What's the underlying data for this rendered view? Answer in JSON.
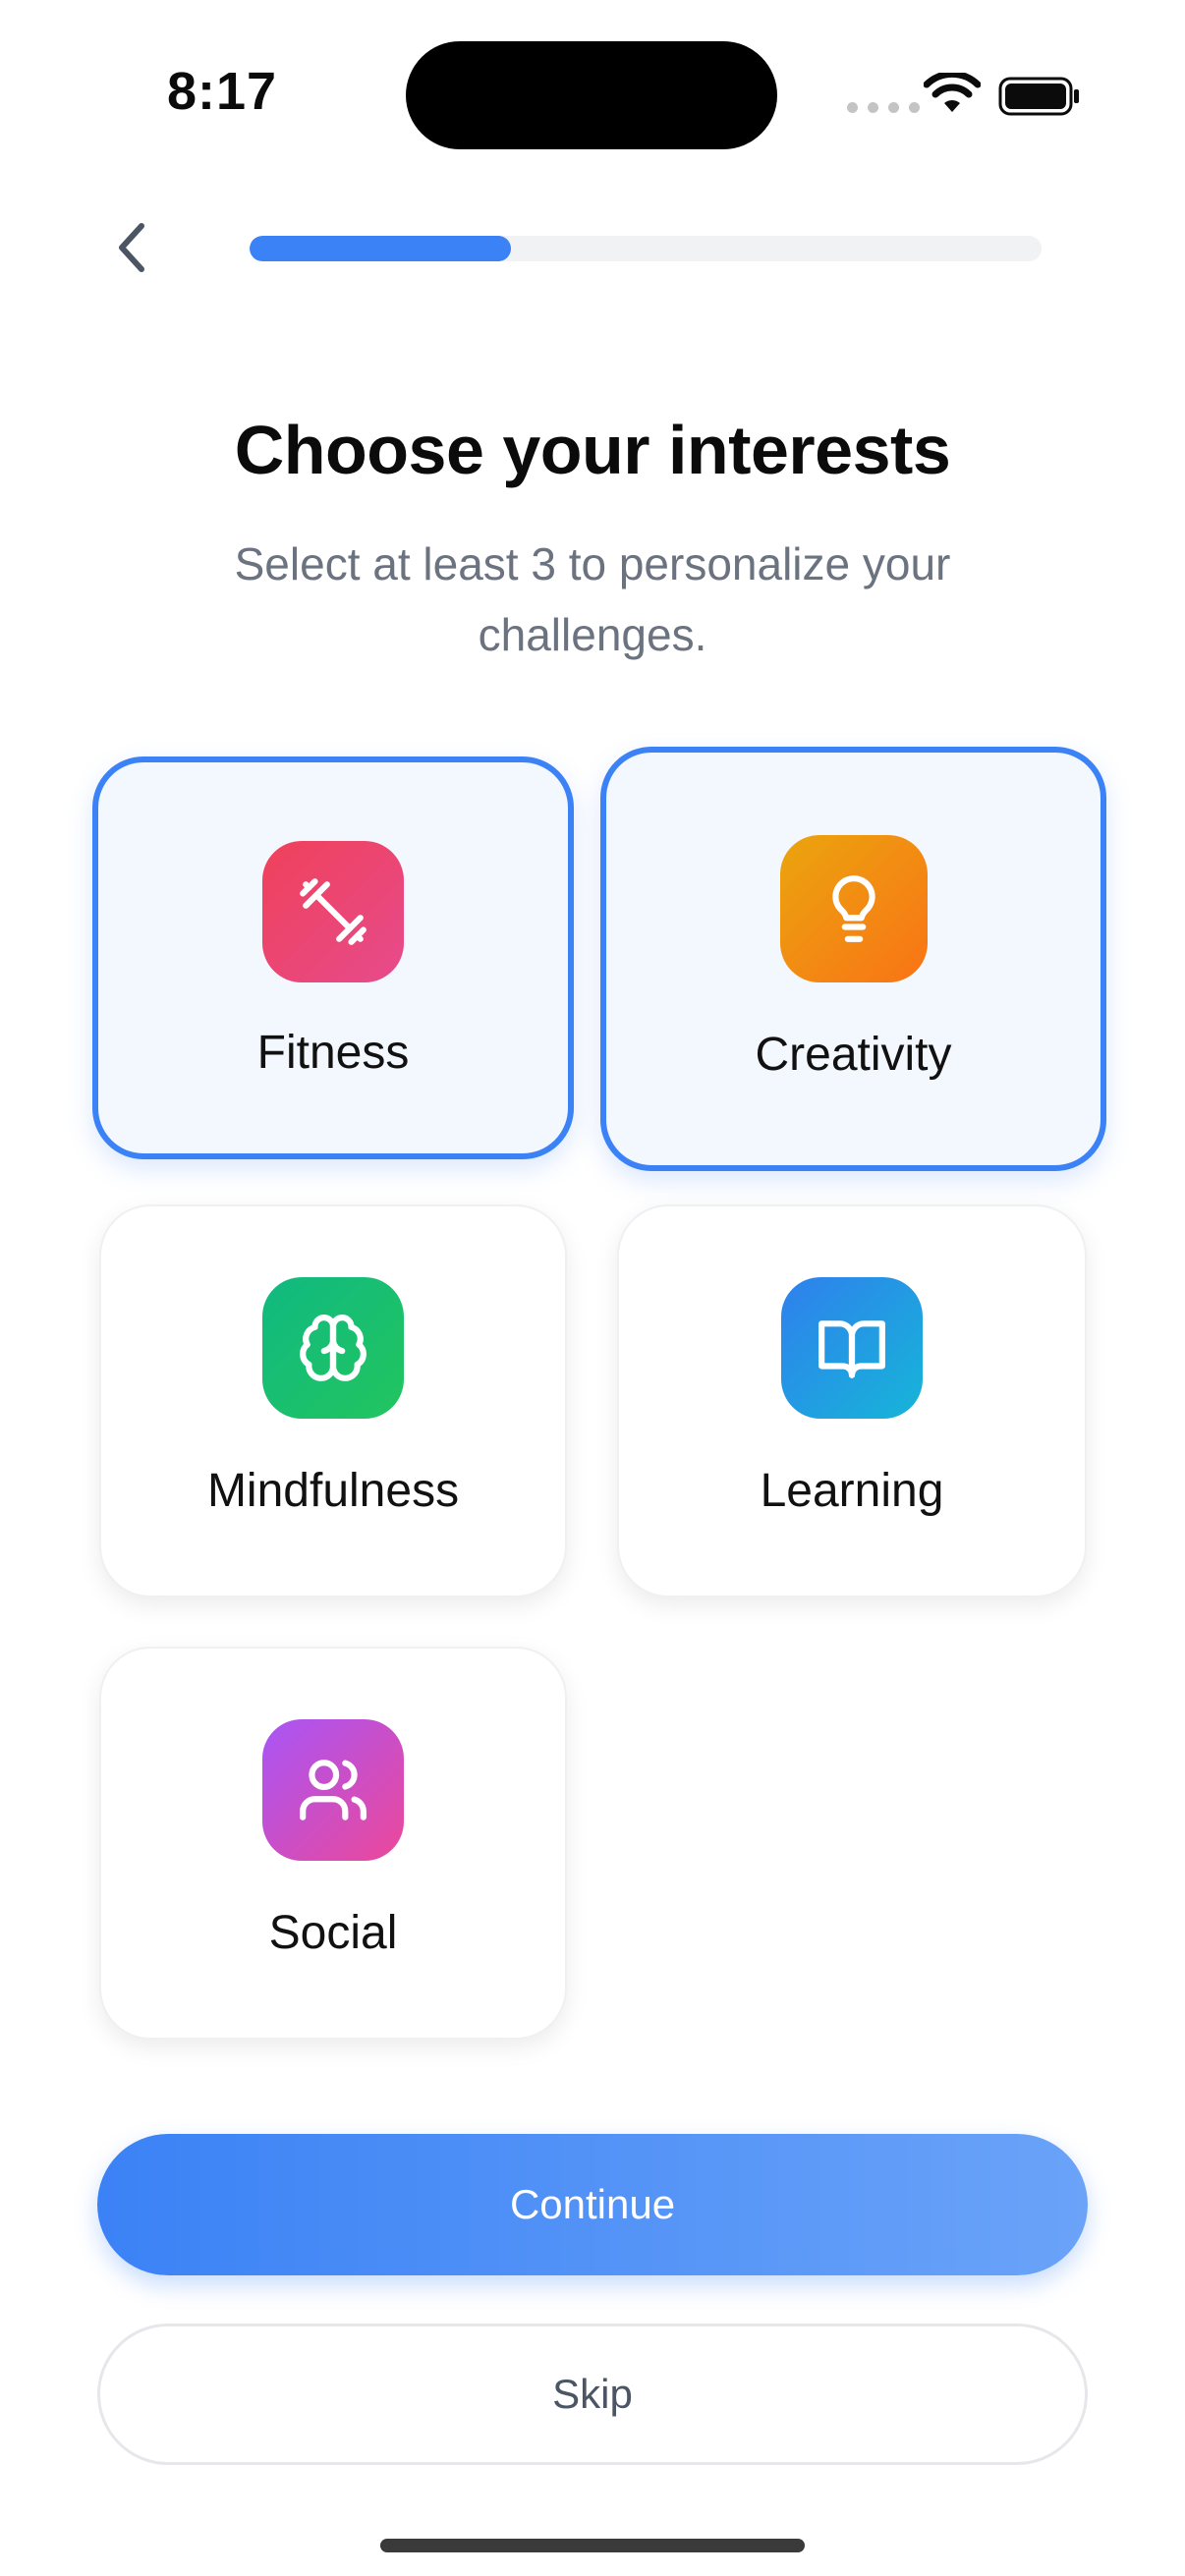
{
  "status_bar": {
    "time": "8:17"
  },
  "progress": {
    "value": 0.33
  },
  "header": {
    "title": "Choose your interests",
    "subtitle": "Select at least 3 to personalize your challenges."
  },
  "interests": [
    {
      "label": "Fitness",
      "icon": "dumbbell-icon",
      "selected": true,
      "gradient": [
        "#f0415a",
        "#e64b8c"
      ]
    },
    {
      "label": "Creativity",
      "icon": "lightbulb-icon",
      "selected": true,
      "gradient": [
        "#eba50e",
        "#f97316"
      ]
    },
    {
      "label": "Mindfulness",
      "icon": "brain-icon",
      "selected": false,
      "gradient": [
        "#10b981",
        "#22c55e"
      ]
    },
    {
      "label": "Learning",
      "icon": "book-icon",
      "selected": false,
      "gradient": [
        "#2f80ed",
        "#16b5d8"
      ]
    },
    {
      "label": "Social",
      "icon": "users-icon",
      "selected": false,
      "gradient": [
        "#a855f7",
        "#ec4899"
      ]
    }
  ],
  "buttons": {
    "continue": "Continue",
    "skip": "Skip"
  },
  "colors": {
    "accent": "#3b82f6"
  }
}
